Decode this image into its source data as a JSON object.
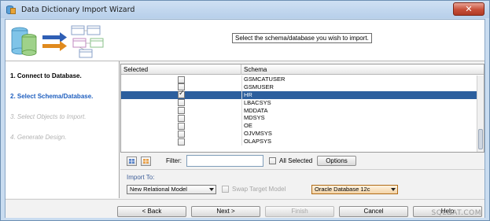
{
  "window": {
    "title": "Data Dictionary Import Wizard",
    "close_label": "✕"
  },
  "header": {
    "instruction": "Select the schema/database you wish to import."
  },
  "steps": [
    {
      "label": "1. Connect to Database.",
      "state": "done"
    },
    {
      "label": "2. Select Schema/Database.",
      "state": "current"
    },
    {
      "label": "3. Select Objects to Import.",
      "state": "todo"
    },
    {
      "label": "4. Generate Design.",
      "state": "todo"
    }
  ],
  "grid": {
    "columns": [
      "Selected",
      "Schema"
    ],
    "rows": [
      {
        "schema": "GSMCATUSER",
        "checked": false
      },
      {
        "schema": "GSMUSER",
        "checked": false
      },
      {
        "schema": "HR",
        "checked": true
      },
      {
        "schema": "LBACSYS",
        "checked": false
      },
      {
        "schema": "MDDATA",
        "checked": false
      },
      {
        "schema": "MDSYS",
        "checked": false
      },
      {
        "schema": "OE",
        "checked": false
      },
      {
        "schema": "OJVMSYS",
        "checked": false
      },
      {
        "schema": "OLAPSYS",
        "checked": false
      }
    ],
    "check_glyph": "✓"
  },
  "filter": {
    "label": "Filter:",
    "value": "",
    "all_selected_label": "All Selected",
    "options_label": "Options"
  },
  "import_to": {
    "label": "Import To:",
    "model_value": "New Relational Model",
    "swap_label": "Swap Target Model",
    "db_value": "Oracle Database 12c"
  },
  "footer": {
    "back": "< Back",
    "next": "Next >",
    "finish": "Finish",
    "cancel": "Cancel",
    "help": "Help"
  },
  "watermark": "SQLDAT.COM",
  "colors": {
    "selection": "#2c5f9e",
    "current_step": "#1f5fbf",
    "import_label": "#3f5f99"
  }
}
